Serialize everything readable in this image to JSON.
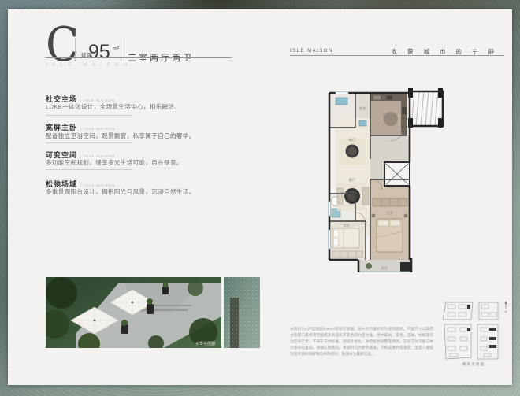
{
  "left_page": {
    "unit_letter": "C",
    "area_prefix": "建面",
    "area_value": "95",
    "area_unit": "m²",
    "spec": "三室两厅两卫",
    "watermark": "ISLE MAISON",
    "sections": [
      {
        "title": "社交主场",
        "tag": "| ISLE MAISON",
        "body": "LDKB一体化设计，全场景生活中心，相乐融洽。"
      },
      {
        "title": "宽屏主卧",
        "tag": "| ISLE MAISON",
        "body": "配备独立卫浴空间，观景飘窗，私享属于自己的奢华。"
      },
      {
        "title": "可变空间",
        "tag": "| ISLE MAISON",
        "body": "多功能空间规划，慢享多元生活可能，自在惬意。"
      },
      {
        "title": "松弛场域",
        "tag": "| ISLE MAISON",
        "body": "多重景观阳台设计，拥抱阳光与风景，沉浸自然生活。"
      }
    ],
    "photo_caption": "实景拍摄图"
  },
  "right_page": {
    "brand": "ISLE MAISON",
    "slogan": "收获城市的宁静",
    "floorplan": {
      "rooms": [
        {
          "label": "玄关"
        },
        {
          "label": "厨房"
        },
        {
          "label": "餐厅"
        },
        {
          "label": "客厅"
        },
        {
          "label": "卫生间"
        },
        {
          "label": "次卧"
        },
        {
          "label": "主卧"
        },
        {
          "label": "阳台"
        }
      ]
    },
    "keyplan_caption": "楼栋示意图",
    "north_label": "N",
    "disclaimer": "本资料为C户型建面约95m²装修示意图，图中所示面积均为建筑面积，户型尺寸以政府主管部门最终审定图纸及商品房买卖合同约定为准。图中家具、家电、洁具、绿植等仅为空间示意，不属于交付标准。因设计优化、政府规划调整等原因，实际交付可能与本示意存在差异，敬请实地看房。本资料仅为要约邀请，不构成要约或承诺，出卖人保留对宣传资料的解释与修改权利，敬请关注最新信息。"
  },
  "colors": {
    "page_bg": "#f3f2f0",
    "wall": "#2a2a2a",
    "water_fixture_blue": "#8fbfcd",
    "wood_floor": "#cfc1ad",
    "border_texture_green": "#6d7f76"
  }
}
